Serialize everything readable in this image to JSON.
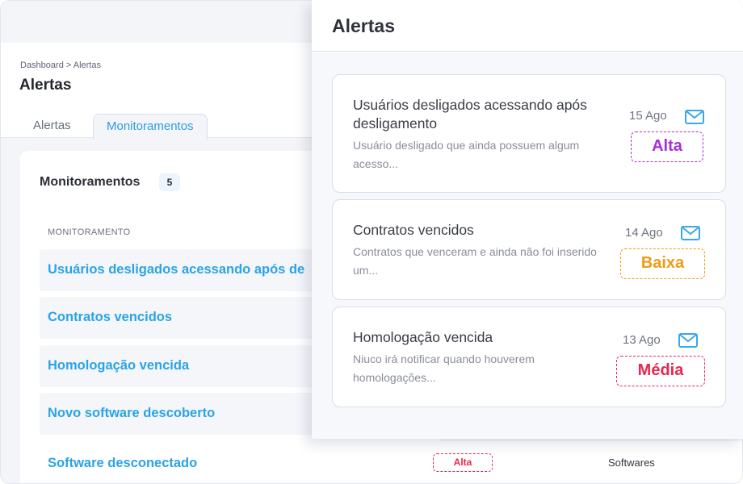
{
  "breadcrumb": "Dashboard > Alertas",
  "page_title": "Alertas",
  "tabs": [
    {
      "label": "Alertas"
    },
    {
      "label": "Monitoramentos"
    }
  ],
  "monitoramentos": {
    "title": "Monitoramentos",
    "count": "5",
    "column_header": "MONITORAMENTO",
    "rows": [
      {
        "label": "Usuários desligados acessando após de"
      },
      {
        "label": "Contratos vencidos"
      },
      {
        "label": "Homologação vencida"
      },
      {
        "label": "Novo software descoberto"
      },
      {
        "label": "Software desconectado",
        "priority": "Alta",
        "category": "Softwares"
      }
    ]
  },
  "alerts_panel": {
    "title": "Alertas",
    "cards": [
      {
        "title": "Usuários desligados acessando após desligamento",
        "description": "Usuário desligado que ainda possuem algum acesso...",
        "date": "15 Ago",
        "priority": "Alta",
        "priority_color": "#a62fd6"
      },
      {
        "title": "Contratos vencidos",
        "description": "Contratos que venceram e ainda não foi inserido um...",
        "date": "14 Ago",
        "priority": "Baixa",
        "priority_color": "#ef9b14"
      },
      {
        "title": "Homologação vencida",
        "description": "Niuco irá notificar quando houverem homologações...",
        "date": "13 Ago",
        "priority": "Média",
        "priority_color": "#e8284e"
      }
    ]
  },
  "colors": {
    "accent": "#2aa3e8",
    "mail_icon": "#3aa7ea"
  },
  "icons": {
    "mail": "mail-icon"
  }
}
